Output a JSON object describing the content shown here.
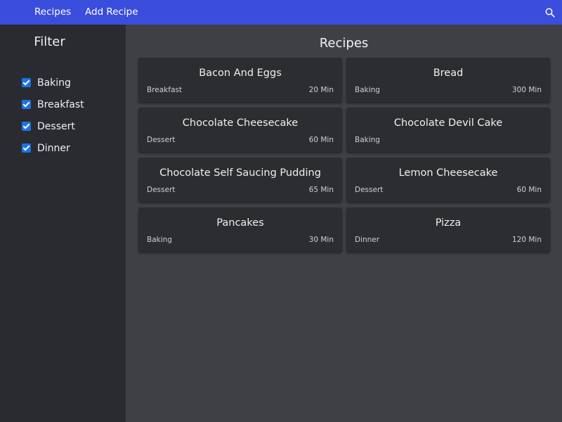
{
  "nav": {
    "recipes_label": "Recipes",
    "add_recipe_label": "Add Recipe",
    "search_icon": "search-icon",
    "bar_color": "#3b4ddd"
  },
  "sidebar": {
    "title": "Filter",
    "filters": [
      {
        "label": "Baking",
        "checked": true
      },
      {
        "label": "Breakfast",
        "checked": true
      },
      {
        "label": "Dessert",
        "checked": true
      },
      {
        "label": "Dinner",
        "checked": true
      }
    ]
  },
  "main": {
    "title": "Recipes",
    "recipes": [
      {
        "name": "Bacon And Eggs",
        "category": "Breakfast",
        "time": "20 Min"
      },
      {
        "name": "Bread",
        "category": "Baking",
        "time": "300 Min"
      },
      {
        "name": "Chocolate Cheesecake",
        "category": "Dessert",
        "time": "60 Min"
      },
      {
        "name": "Chocolate Devil Cake",
        "category": "Baking",
        "time": ""
      },
      {
        "name": "Chocolate Self Saucing Pudding",
        "category": "Dessert",
        "time": "65 Min"
      },
      {
        "name": "Lemon Cheesecake",
        "category": "Dessert",
        "time": "60 Min"
      },
      {
        "name": "Pancakes",
        "category": "Baking",
        "time": "30 Min"
      },
      {
        "name": "Pizza",
        "category": "Dinner",
        "time": "120 Min"
      }
    ]
  }
}
